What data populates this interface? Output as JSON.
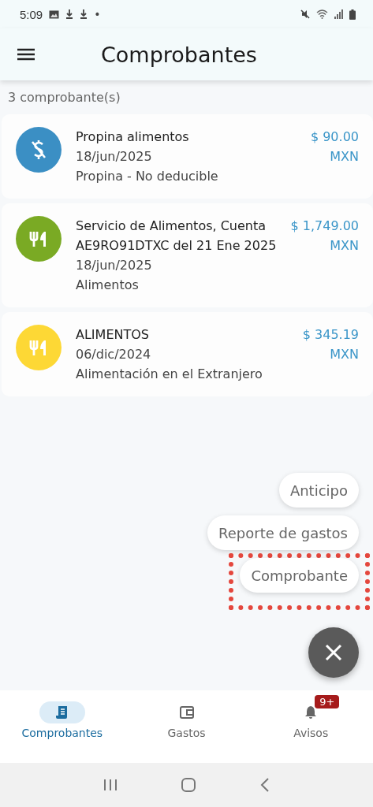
{
  "status_bar": {
    "time": "5:09",
    "notification_dot": "•"
  },
  "app_bar": {
    "title": "Comprobantes"
  },
  "count_label": "3 comprobante(s)",
  "receipts": [
    {
      "kind": "tip",
      "color": "#3b8fc4",
      "title": "Propina alimentos",
      "date": "18/jun/2025",
      "category": "Propina - No deducible",
      "amount": "$ 90.00",
      "currency": "MXN"
    },
    {
      "kind": "food",
      "color": "#7aaa24",
      "title": "Servicio de Alimentos, Cuenta AE9RO91DTXC del 21 Ene 2025",
      "date": "18/jun/2025",
      "category": "Alimentos",
      "amount": "$ 1,749.00",
      "currency": "MXN"
    },
    {
      "kind": "food",
      "color": "#fdd835",
      "title": "ALIMENTOS",
      "date": "06/dic/2024",
      "category": "Alimentación en el Extranjero",
      "amount": "$ 345.19",
      "currency": "MXN"
    }
  ],
  "speed_dial": {
    "expanded": true,
    "actions": [
      {
        "label": "Anticipo",
        "highlighted": false
      },
      {
        "label": "Reporte de gastos",
        "highlighted": false
      },
      {
        "label": "Comprobante",
        "highlighted": true
      }
    ]
  },
  "bottom_nav": [
    {
      "kind": "receipt",
      "label": "Comprobantes",
      "selected": true
    },
    {
      "kind": "wallet",
      "label": "Gastos",
      "selected": false
    },
    {
      "kind": "bell",
      "label": "Avisos",
      "selected": false,
      "badge": "9+"
    }
  ]
}
